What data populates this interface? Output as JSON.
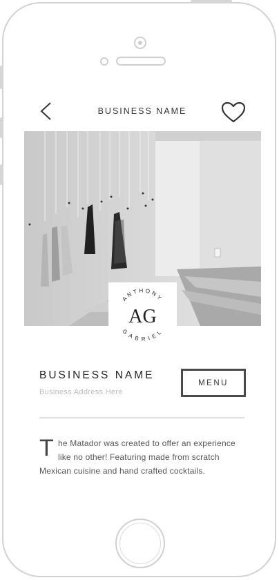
{
  "header": {
    "title": "BUSINESS NAME",
    "back_icon": "chevron-left-icon",
    "favorite_icon": "heart-icon"
  },
  "logo": {
    "top_text": "ANTHONY",
    "bottom_text": "GABRIEL",
    "monogram": "AG"
  },
  "business": {
    "name": "BUSINESS NAME",
    "address": "Business Address Here",
    "menu_label": "MENU"
  },
  "description": {
    "drop_cap": "T",
    "text": "he Matador was created to offer an experience like no other! Featuring made from scratch Mexican cuisine and hand crafted cocktails."
  }
}
